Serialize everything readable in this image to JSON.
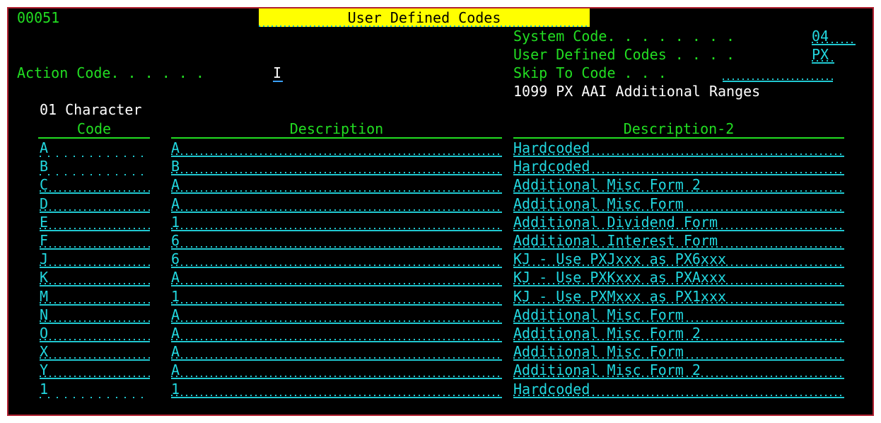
{
  "screen": {
    "program_id": "00051",
    "title": "User Defined Codes"
  },
  "header": {
    "system_code_label": "System Code. . . . . . . .",
    "system_code_value": "04",
    "udc_label": "User Defined Codes . . . .",
    "udc_value": "PX",
    "action_code_label": "Action Code. . . . . .",
    "action_code_value": "I",
    "skip_to_label": "Skip To Code . . .",
    "skip_to_value": "",
    "udc_description": "1099 PX AAI Additional Ranges",
    "code_type": "01 Character"
  },
  "table": {
    "columns": [
      "Code",
      "Description",
      "Description-2"
    ],
    "rows": [
      {
        "code": "A",
        "desc": "A",
        "desc2": "Hardcoded"
      },
      {
        "code": "B",
        "desc": "B",
        "desc2": "Hardcoded"
      },
      {
        "code": "C",
        "desc": "A",
        "desc2": "Additional Misc Form 2"
      },
      {
        "code": "D",
        "desc": "A",
        "desc2": "Additional Misc Form"
      },
      {
        "code": "E",
        "desc": "1",
        "desc2": "Additional Dividend Form"
      },
      {
        "code": "F",
        "desc": "6",
        "desc2": "Additional Interest Form"
      },
      {
        "code": "J",
        "desc": "6",
        "desc2": "KJ - Use PXJxxx as PX6xxx"
      },
      {
        "code": "K",
        "desc": "A",
        "desc2": "KJ - Use PXKxxx as PXAxxx"
      },
      {
        "code": "M",
        "desc": "1",
        "desc2": "KJ - Use PXMxxx as PX1xxx"
      },
      {
        "code": "N",
        "desc": "A",
        "desc2": "Additional Misc Form"
      },
      {
        "code": "O",
        "desc": "A",
        "desc2": "Additional Misc Form 2"
      },
      {
        "code": "X",
        "desc": "A",
        "desc2": "Additional Misc Form"
      },
      {
        "code": "Y",
        "desc": "A",
        "desc2": "Additional Misc Form 2"
      },
      {
        "code": "1",
        "desc": "1",
        "desc2": "Hardcoded"
      }
    ]
  },
  "colors": {
    "background": "#000000",
    "label_green": "#22dd22",
    "field_cyan": "#22d8e0",
    "title_yellow": "#ffff00",
    "frame_border": "#b02030"
  }
}
